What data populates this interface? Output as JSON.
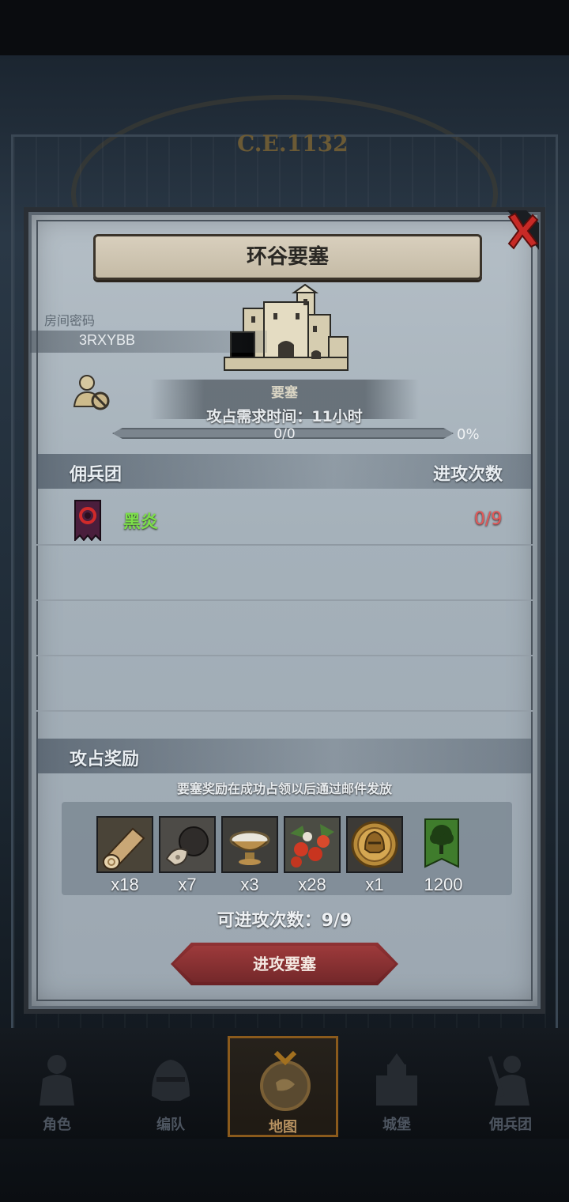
{
  "background": {
    "era_label": "C.E.1132"
  },
  "dialog": {
    "title": "环谷要塞",
    "room_code_label": "房间密码",
    "room_code": "3RXYBB",
    "fort_type": "要塞",
    "capture_time": "攻占需求时间：11小时",
    "progress": {
      "text": "0/0",
      "percent_label": "0%",
      "percent": 0
    }
  },
  "mercenary_section": {
    "title": "佣兵团",
    "attacks_header": "进攻次数",
    "rows": [
      {
        "name": "黑炎",
        "attacks": "0/9",
        "banner_icon": "black-flame-banner-icon"
      }
    ]
  },
  "reward_section": {
    "title": "攻占奖励",
    "note": "要塞奖励在成功占领以后通过邮件发放",
    "items": [
      {
        "icon": "wood-log-icon",
        "qty": "x18"
      },
      {
        "icon": "truffle-icon",
        "qty": "x7"
      },
      {
        "icon": "dish-bowl-icon",
        "qty": "x3"
      },
      {
        "icon": "berries-icon",
        "qty": "x28"
      },
      {
        "icon": "knight-medal-icon",
        "qty": "x1"
      },
      {
        "icon": "tree-banner-icon",
        "qty": "1200"
      }
    ]
  },
  "attack_count": "可进攻次数：9/9",
  "attack_button": "进攻要塞",
  "nav": [
    {
      "label": "角色",
      "icon": "knight-icon"
    },
    {
      "label": "编队",
      "icon": "helmet-icon"
    },
    {
      "label": "地图",
      "icon": "map-compass-icon",
      "active": true
    },
    {
      "label": "城堡",
      "icon": "castle-icon"
    },
    {
      "label": "佣兵团",
      "icon": "warrior-icon"
    }
  ],
  "colors": {
    "merc_name": "#7de04a",
    "attacks_value": "#e45858",
    "button": "#8f3234",
    "panel": "#a5b1ba"
  }
}
